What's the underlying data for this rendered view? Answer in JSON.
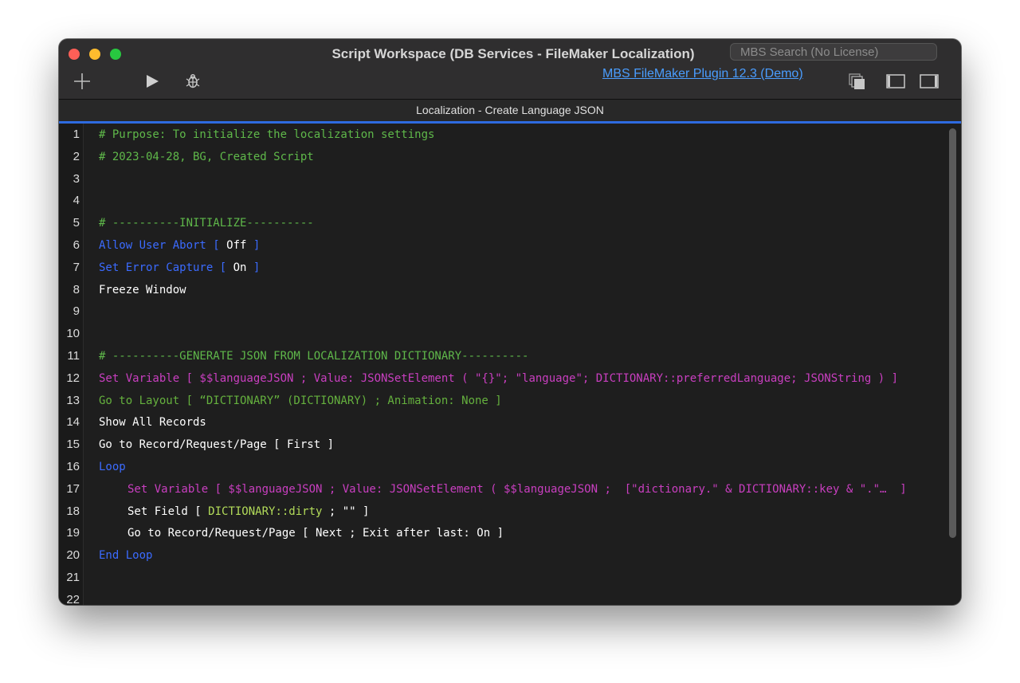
{
  "window": {
    "title": "Script Workspace (DB Services - FileMaker Localization)",
    "search_placeholder": "MBS Search (No License)",
    "plugin_link": "MBS FileMaker Plugin 12.3 (Demo)"
  },
  "toolbar": {
    "icons": [
      "plus-icon",
      "play-icon",
      "debug-bug-icon",
      "windows-icon",
      "left-panel-icon",
      "right-panel-icon"
    ]
  },
  "tab": {
    "title": "Localization - Create Language JSON"
  },
  "colors": {
    "comment": "#5fb84a",
    "control_step": "#3b6bff",
    "variable_step": "#c93fc0",
    "layout_step": "#65b13e",
    "plain_step": "#ffffff",
    "field_ref": "#b3dc5a",
    "tab_accent": "#2e6be0"
  },
  "script": {
    "lines": [
      {
        "n": "1",
        "indent": 0,
        "segs": [
          {
            "t": "# Purpose: To initialize the localization settings",
            "c": "cmt"
          }
        ]
      },
      {
        "n": "2",
        "indent": 0,
        "segs": [
          {
            "t": "# 2023-04-28, BG, Created Script",
            "c": "cmt"
          }
        ]
      },
      {
        "n": "3",
        "indent": 0,
        "segs": []
      },
      {
        "n": "4",
        "indent": 0,
        "segs": []
      },
      {
        "n": "5",
        "indent": 0,
        "segs": [
          {
            "t": "# ----------INITIALIZE----------",
            "c": "cmt"
          }
        ]
      },
      {
        "n": "6",
        "indent": 0,
        "segs": [
          {
            "t": "Allow User Abort [ ",
            "c": "kw"
          },
          {
            "t": "Off",
            "c": "wht"
          },
          {
            "t": " ]",
            "c": "kw"
          }
        ]
      },
      {
        "n": "7",
        "indent": 0,
        "segs": [
          {
            "t": "Set Error Capture [ ",
            "c": "kw"
          },
          {
            "t": "On",
            "c": "wht"
          },
          {
            "t": " ]",
            "c": "kw"
          }
        ]
      },
      {
        "n": "8",
        "indent": 0,
        "segs": [
          {
            "t": "Freeze Window",
            "c": "wht"
          }
        ]
      },
      {
        "n": "9",
        "indent": 0,
        "segs": []
      },
      {
        "n": "10",
        "indent": 0,
        "segs": []
      },
      {
        "n": "11",
        "indent": 0,
        "segs": [
          {
            "t": "# ----------GENERATE JSON FROM LOCALIZATION DICTIONARY----------",
            "c": "cmt"
          }
        ]
      },
      {
        "n": "12",
        "indent": 0,
        "segs": [
          {
            "t": "Set Variable [ $$languageJSON ; Value: JSONSetElement ( \"{}\"; \"language\"; DICTIONARY::preferredLanguage; JSONString ) ]",
            "c": "mag"
          }
        ]
      },
      {
        "n": "13",
        "indent": 0,
        "segs": [
          {
            "t": "Go to Layout [ “DICTIONARY” (DICTIONARY) ; Animation: None ]",
            "c": "grn"
          }
        ]
      },
      {
        "n": "14",
        "indent": 0,
        "segs": [
          {
            "t": "Show All Records",
            "c": "wht"
          }
        ]
      },
      {
        "n": "15",
        "indent": 0,
        "segs": [
          {
            "t": "Go to Record/Request/Page [ First ]",
            "c": "wht"
          }
        ]
      },
      {
        "n": "16",
        "indent": 0,
        "segs": [
          {
            "t": "Loop",
            "c": "kw"
          }
        ]
      },
      {
        "n": "17",
        "indent": 1,
        "segs": [
          {
            "t": "Set Variable [ $$languageJSON ; Value: JSONSetElement ( $$languageJSON ;  [\"dictionary.\" & DICTIONARY::key & \".\"…  ]",
            "c": "mag"
          }
        ]
      },
      {
        "n": "18",
        "indent": 1,
        "segs": [
          {
            "t": "Set Field [ ",
            "c": "wht"
          },
          {
            "t": "DICTIONARY::dirty",
            "c": "fld"
          },
          {
            "t": " ; \"\" ]",
            "c": "wht"
          }
        ]
      },
      {
        "n": "19",
        "indent": 1,
        "segs": [
          {
            "t": "Go to Record/Request/Page [ Next ; Exit after last: On ]",
            "c": "wht"
          }
        ]
      },
      {
        "n": "20",
        "indent": 0,
        "segs": [
          {
            "t": "End Loop",
            "c": "kw"
          }
        ]
      },
      {
        "n": "21",
        "indent": 0,
        "segs": []
      },
      {
        "n": "22",
        "indent": 0,
        "segs": []
      }
    ]
  }
}
